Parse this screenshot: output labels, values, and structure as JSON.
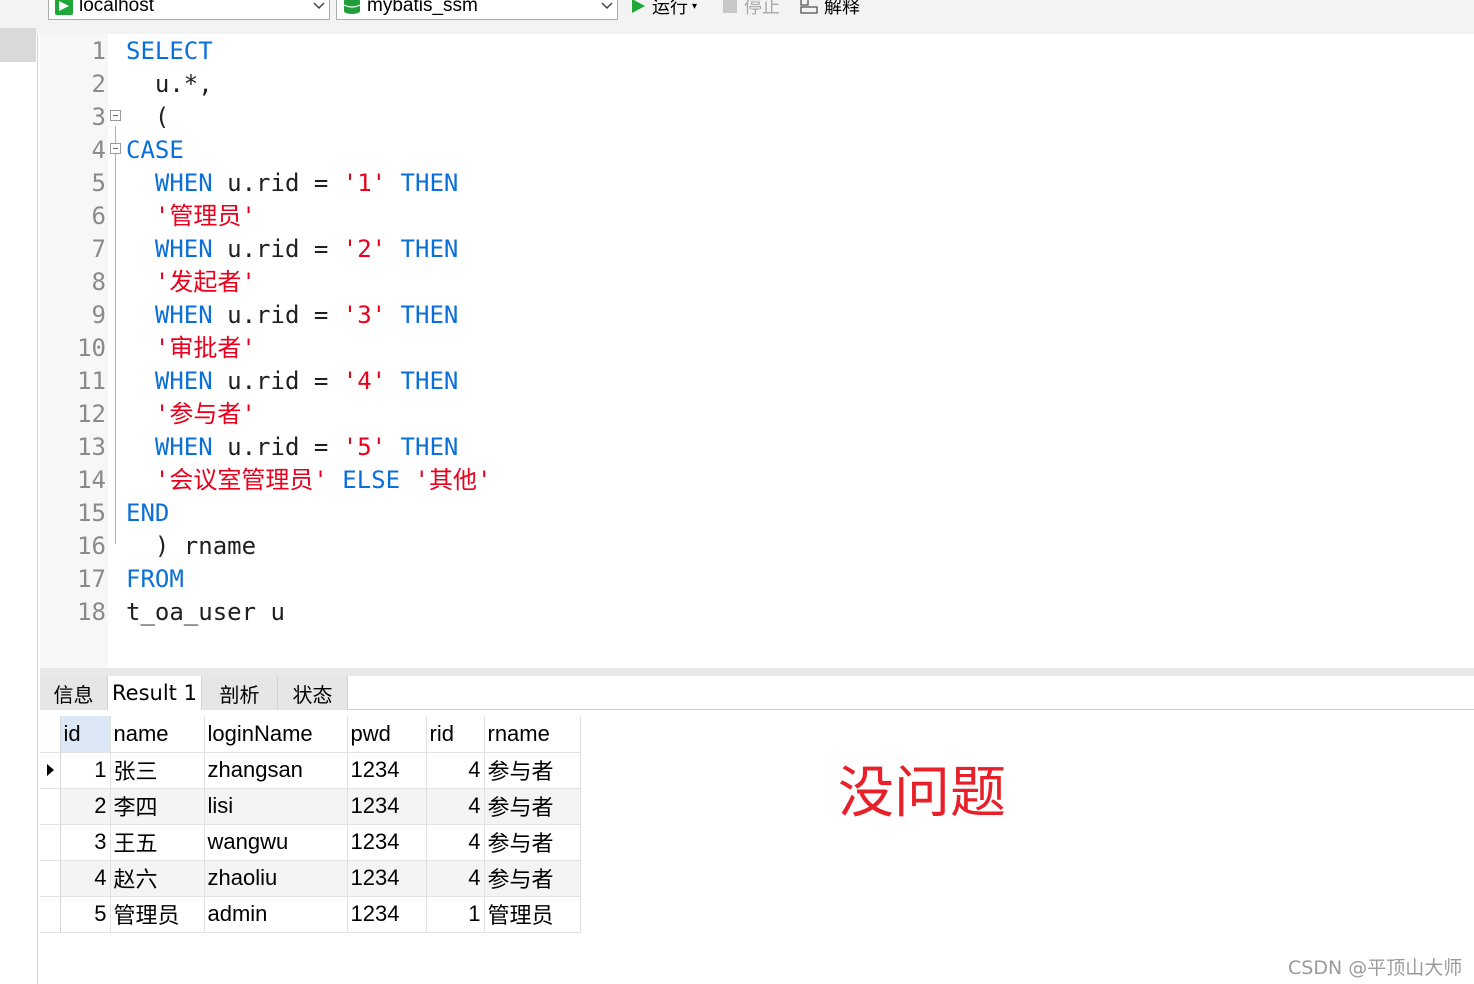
{
  "toolbar": {
    "connection": "localhost",
    "database": "mybatis_ssm",
    "run_label": "运行",
    "stop_label": "停止",
    "explain_label": "解释"
  },
  "editor": {
    "lines": [
      {
        "num": "1",
        "tokens": [
          {
            "t": "SELECT",
            "c": "kw"
          }
        ]
      },
      {
        "num": "2",
        "tokens": [
          {
            "t": "  u.*,",
            "c": "pl"
          }
        ]
      },
      {
        "num": "3",
        "tokens": [
          {
            "t": "  (",
            "c": "pl"
          }
        ]
      },
      {
        "num": "4",
        "tokens": [
          {
            "t": "CASE",
            "c": "kw"
          }
        ]
      },
      {
        "num": "5",
        "tokens": [
          {
            "t": "  WHEN ",
            "c": "kw"
          },
          {
            "t": "u.rid = ",
            "c": "pl"
          },
          {
            "t": "'1'",
            "c": "str"
          },
          {
            "t": " THEN",
            "c": "kw"
          }
        ]
      },
      {
        "num": "6",
        "tokens": [
          {
            "t": "  '管理员'",
            "c": "str"
          }
        ]
      },
      {
        "num": "7",
        "tokens": [
          {
            "t": "  WHEN ",
            "c": "kw"
          },
          {
            "t": "u.rid = ",
            "c": "pl"
          },
          {
            "t": "'2'",
            "c": "str"
          },
          {
            "t": " THEN",
            "c": "kw"
          }
        ]
      },
      {
        "num": "8",
        "tokens": [
          {
            "t": "  '发起者'",
            "c": "str"
          }
        ]
      },
      {
        "num": "9",
        "tokens": [
          {
            "t": "  WHEN ",
            "c": "kw"
          },
          {
            "t": "u.rid = ",
            "c": "pl"
          },
          {
            "t": "'3'",
            "c": "str"
          },
          {
            "t": " THEN",
            "c": "kw"
          }
        ]
      },
      {
        "num": "10",
        "tokens": [
          {
            "t": "  '审批者'",
            "c": "str"
          }
        ]
      },
      {
        "num": "11",
        "tokens": [
          {
            "t": "  WHEN ",
            "c": "kw"
          },
          {
            "t": "u.rid = ",
            "c": "pl"
          },
          {
            "t": "'4'",
            "c": "str"
          },
          {
            "t": " THEN",
            "c": "kw"
          }
        ]
      },
      {
        "num": "12",
        "tokens": [
          {
            "t": "  '参与者'",
            "c": "str"
          }
        ]
      },
      {
        "num": "13",
        "tokens": [
          {
            "t": "  WHEN ",
            "c": "kw"
          },
          {
            "t": "u.rid = ",
            "c": "pl"
          },
          {
            "t": "'5'",
            "c": "str"
          },
          {
            "t": " THEN",
            "c": "kw"
          }
        ]
      },
      {
        "num": "14",
        "tokens": [
          {
            "t": "  '会议室管理员'",
            "c": "str"
          },
          {
            "t": " ELSE ",
            "c": "kw"
          },
          {
            "t": "'其他'",
            "c": "str"
          }
        ]
      },
      {
        "num": "15",
        "tokens": [
          {
            "t": "END",
            "c": "kw"
          }
        ]
      },
      {
        "num": "16",
        "tokens": [
          {
            "t": "  ) rname",
            "c": "pl"
          }
        ]
      },
      {
        "num": "17",
        "tokens": [
          {
            "t": "FROM",
            "c": "kw"
          }
        ]
      },
      {
        "num": "18",
        "tokens": [
          {
            "t": "t_oa_user u",
            "c": "pl"
          }
        ]
      }
    ]
  },
  "result": {
    "tabs": [
      "信息",
      "Result 1",
      "剖析",
      "状态"
    ],
    "active_tab": "Result 1",
    "columns": [
      "id",
      "name",
      "loginName",
      "pwd",
      "rid",
      "rname"
    ],
    "rows": [
      [
        "1",
        "张三",
        "zhangsan",
        "1234",
        "4",
        "参与者"
      ],
      [
        "2",
        "李四",
        "lisi",
        "1234",
        "4",
        "参与者"
      ],
      [
        "3",
        "王五",
        "wangwu",
        "1234",
        "4",
        "参与者"
      ],
      [
        "4",
        "赵六",
        "zhaoliu",
        "1234",
        "4",
        "参与者"
      ],
      [
        "5",
        "管理员",
        "admin",
        "1234",
        "1",
        "管理员"
      ]
    ]
  },
  "annotation": "没问题",
  "watermark": "CSDN @平顶山大师",
  "colors": {
    "keyword": "#0a6fd8",
    "string": "#e8001c",
    "annotation": "#e8202a",
    "run_icon": "#1fa83a",
    "db_icon": "#1e9e3a"
  }
}
